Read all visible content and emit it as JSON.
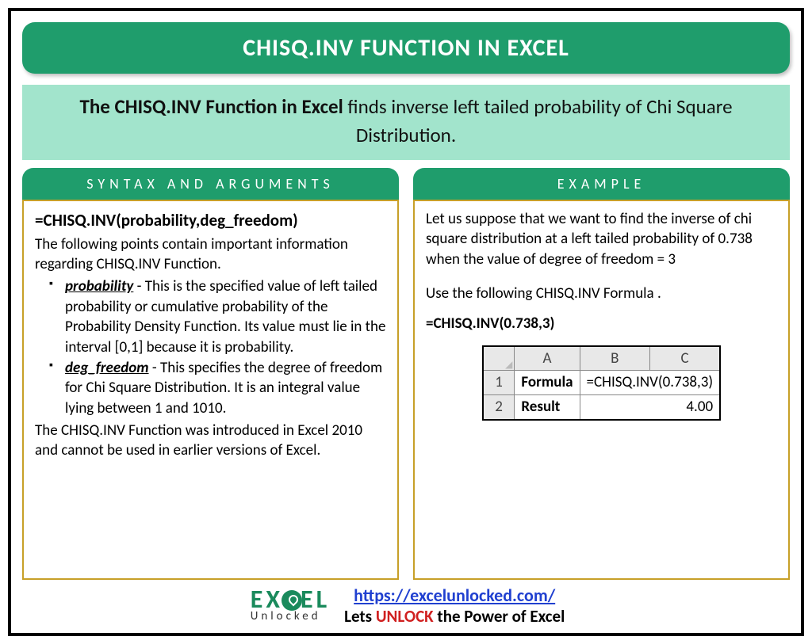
{
  "title": "CHISQ.INV FUNCTION IN EXCEL",
  "description": {
    "bold": "The CHISQ.INV Function in Excel",
    "rest": " finds inverse left tailed probability of Chi Square Distribution."
  },
  "left": {
    "header": "SYNTAX AND ARGUMENTS",
    "formula": "=CHISQ.INV(probability,deg_freedom)",
    "intro": "The following points contain important information regarding CHISQ.INV Function.",
    "args": [
      {
        "name": "probability",
        "text": " - This is the specified value of left tailed probability or cumulative probability of the Probability Density Function. Its value must lie in the interval [0,1] because it is probability."
      },
      {
        "name": "deg_freedom",
        "text": " - This specifies the degree of freedom for Chi Square Distribution. It is an integral value lying between 1 and 1010."
      }
    ],
    "outro": "The CHISQ.INV Function was introduced in Excel 2010 and cannot be used in earlier versions of Excel."
  },
  "right": {
    "header": "EXAMPLE",
    "p1": "Let us suppose that we want to find the inverse of chi square distribution at a left tailed probability of 0.738 when the value of degree of freedom = 3",
    "p2": "Use the following CHISQ.INV Formula .",
    "formula": "=CHISQ.INV(0.738,3)",
    "table": {
      "cols": [
        "A",
        "B",
        "C"
      ],
      "rows": [
        {
          "n": "1",
          "label": "Formula",
          "value": "=CHISQ.INV(0.738,3)"
        },
        {
          "n": "2",
          "label": "Result",
          "value": "4.00"
        }
      ]
    }
  },
  "footer": {
    "logo_top": "EX  EL",
    "logo_bottom": "Unlocked",
    "url": "https://excelunlocked.com/",
    "tagline_pre": "Lets ",
    "tagline_mid": "UNLOCK",
    "tagline_post": " the Power of Excel"
  }
}
